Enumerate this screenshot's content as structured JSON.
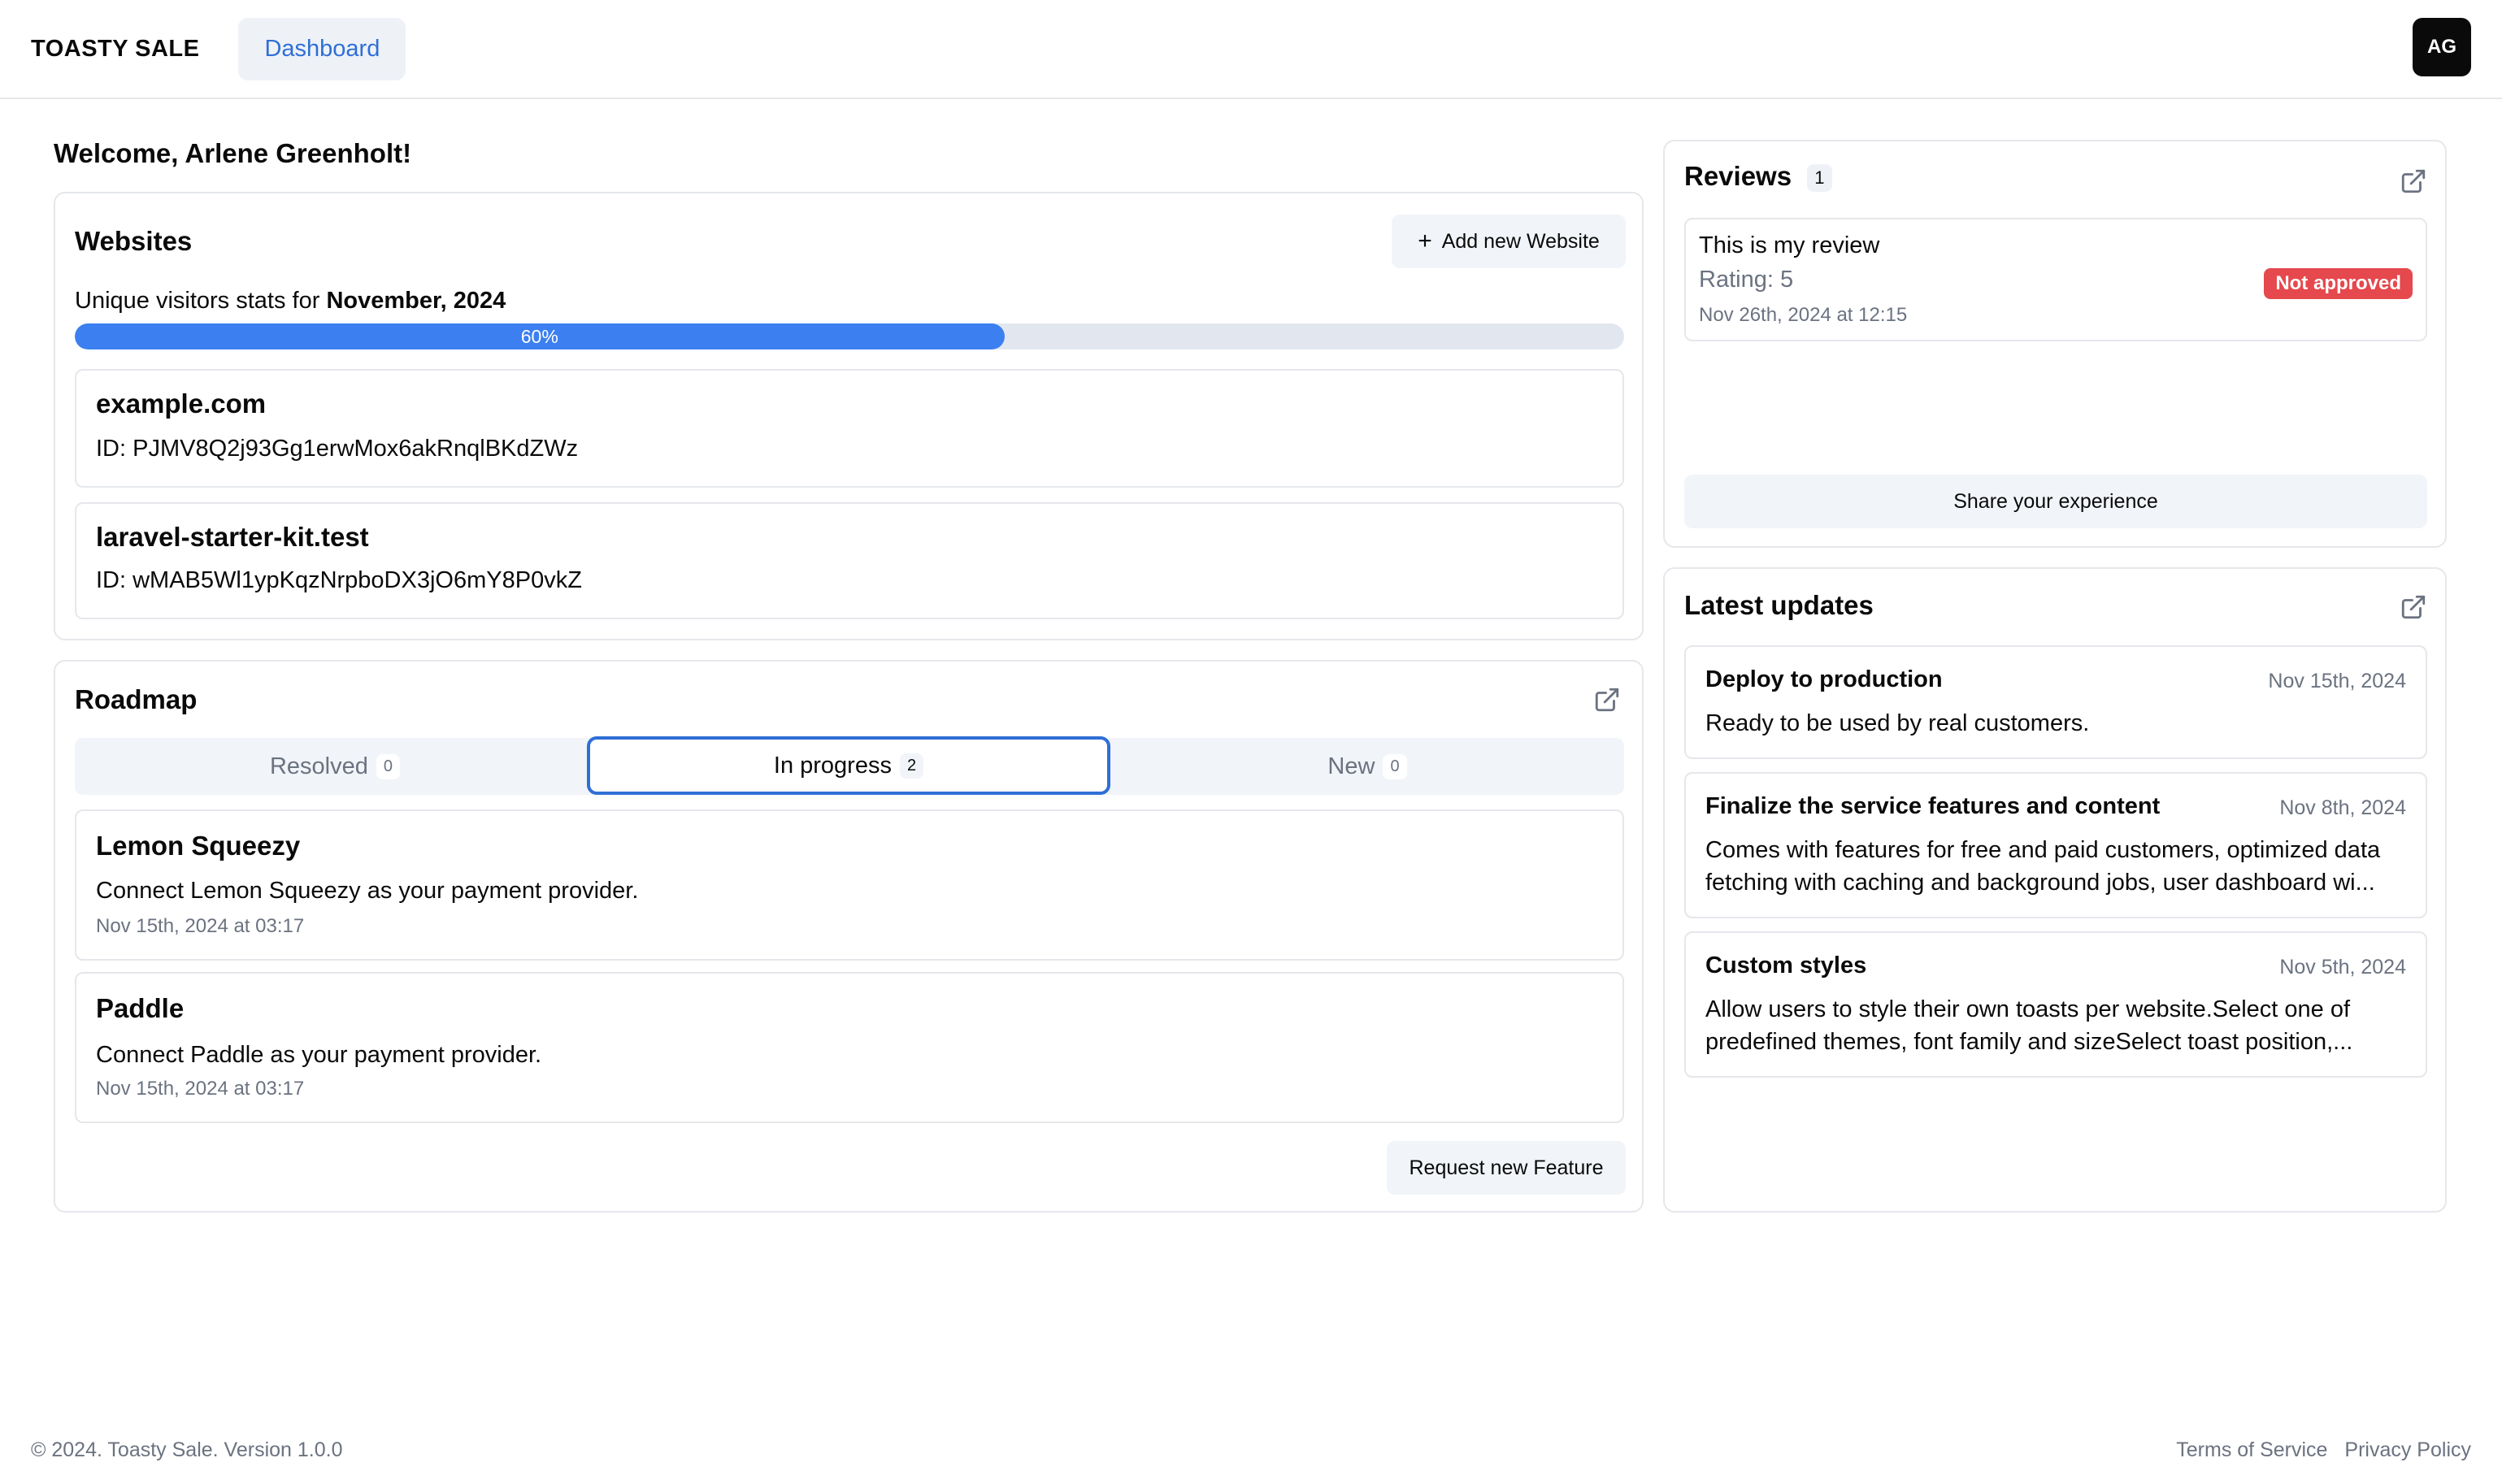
{
  "header": {
    "brand": "TOASTY SALE",
    "nav_dashboard": "Dashboard",
    "avatar_initials": "AG"
  },
  "welcome": "Welcome, Arlene Greenholt!",
  "websites": {
    "title": "Websites",
    "add_button": "Add new Website",
    "add_icon": "plus-icon",
    "stats_prefix": "Unique visitors stats for",
    "stats_period": "November, 2024",
    "progress_label": "60%",
    "progress_value": 0.6,
    "items": [
      {
        "name": "example.com",
        "id": "ID: PJMV8Q2j93Gg1erwMox6akRnqlBKdZWz"
      },
      {
        "name": "laravel-starter-kit.test",
        "id": "ID: wMAB5Wl1ypKqzNrpboDX3jO6mY8P0vkZ"
      }
    ]
  },
  "roadmap": {
    "title": "Roadmap",
    "tabs": [
      {
        "label": "Resolved",
        "count": "0"
      },
      {
        "label": "In progress",
        "count": "2"
      },
      {
        "label": "New",
        "count": "0"
      }
    ],
    "items": [
      {
        "title": "Lemon Squeezy",
        "desc": "Connect Lemon Squeezy as your payment provider.",
        "date": "Nov 15th, 2024 at 03:17"
      },
      {
        "title": "Paddle",
        "desc": "Connect Paddle as your payment provider.",
        "date": "Nov 15th, 2024 at 03:17"
      }
    ],
    "request_button": "Request new Feature"
  },
  "reviews": {
    "title": "Reviews",
    "count": "1",
    "item": {
      "text": "This is my review",
      "rating": "Rating: 5",
      "status": "Not approved",
      "date": "Nov 26th, 2024 at 12:15"
    },
    "share_button": "Share your experience"
  },
  "updates": {
    "title": "Latest updates",
    "items": [
      {
        "title": "Deploy to production",
        "date": "Nov 15th, 2024",
        "desc1": "Ready to be used by real customers.",
        "desc2": ""
      },
      {
        "title": "Finalize the service features and content",
        "date": "Nov 8th, 2024",
        "desc1": "Comes with features for free and paid customers, optimized data",
        "desc2": "fetching with caching and background jobs, user dashboard wi..."
      },
      {
        "title": "Custom styles",
        "date": "Nov 5th, 2024",
        "desc1": "Allow users to style their own toasts per website.Select one of",
        "desc2": "predefined themes, font family and sizeSelect toast position,..."
      }
    ]
  },
  "footer": {
    "copyright": "© 2024. Toasty Sale. Version 1.0.0",
    "terms": "Terms of Service",
    "privacy": "Privacy Policy"
  },
  "colors": {
    "accent": "#3b7ff0",
    "danger": "#e5484d"
  }
}
